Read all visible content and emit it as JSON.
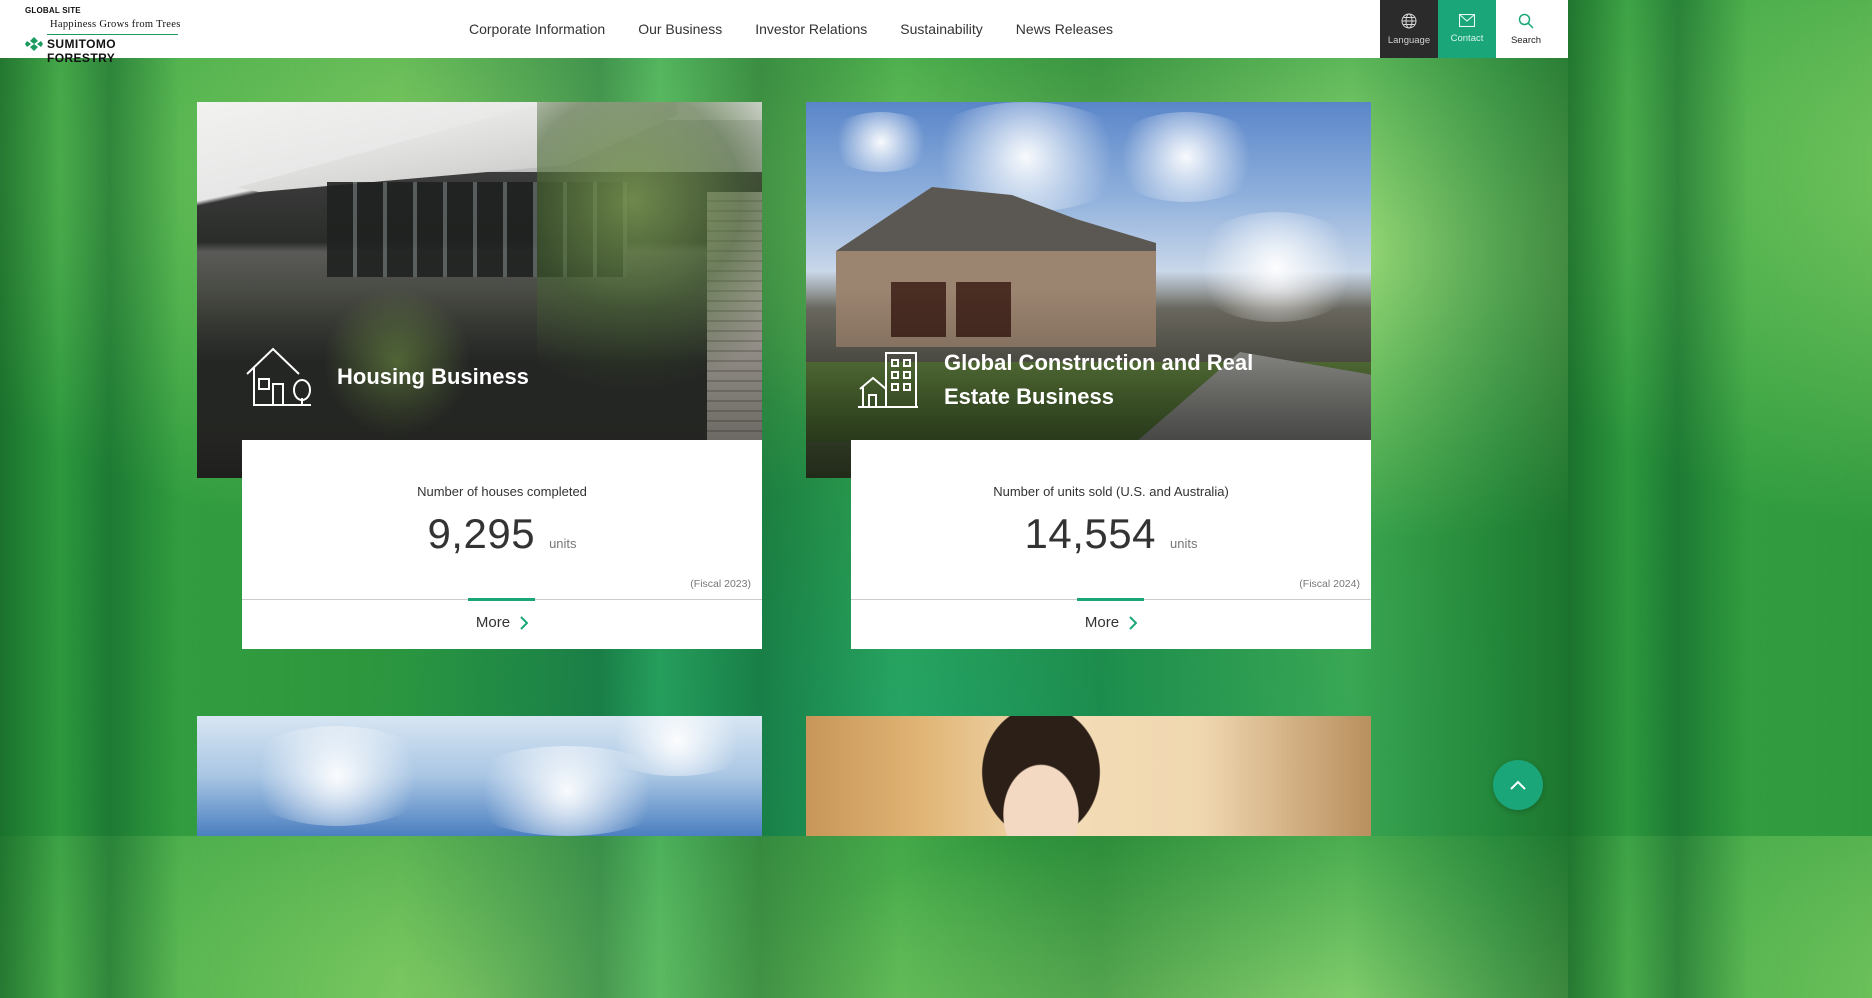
{
  "header": {
    "logo": {
      "global_site": "GLOBAL SITE",
      "tagline": "Happiness Grows from Trees",
      "company": "SUMITOMO FORESTRY"
    },
    "nav": [
      {
        "label": "Corporate Information"
      },
      {
        "label": "Our Business"
      },
      {
        "label": "Investor Relations"
      },
      {
        "label": "Sustainability"
      },
      {
        "label": "News Releases"
      }
    ],
    "utility": {
      "language": "Language",
      "contact": "Contact",
      "search": "Search"
    }
  },
  "cards": [
    {
      "title": "Housing Business",
      "icon": "house-icon",
      "metric_label": "Number of houses completed",
      "value": "9,295",
      "unit": "units",
      "fiscal": "(Fiscal 2023)",
      "more": "More"
    },
    {
      "title": "Global Construction and Real Estate Business",
      "icon": "building-icon",
      "metric_label": "Number of units sold (U.S. and Australia)",
      "value": "14,554",
      "unit": "units",
      "fiscal": "(Fiscal 2024)",
      "more": "More"
    }
  ],
  "colors": {
    "accent": "#1aa679",
    "language_bg": "#2b2b2b",
    "contact_bg": "#1aa679"
  },
  "icons": {
    "language": "globe-icon",
    "contact": "mail-icon",
    "search": "search-icon",
    "more": "chevron-right-icon",
    "to_top": "chevron-up-icon"
  }
}
